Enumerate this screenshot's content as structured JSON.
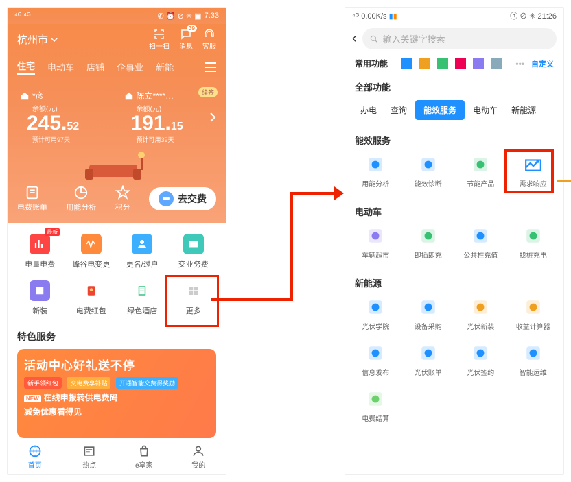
{
  "left": {
    "status": {
      "left": "⁴ᴳ ⁴ᴳ",
      "right": "7:33",
      "icons": "✆ ⏰ ⊘ ✳ ▣"
    },
    "city": "杭州市",
    "top_icons": {
      "scan": "扫一扫",
      "msg": "消息",
      "msg_badge": "39",
      "cs": "客服"
    },
    "tabs": [
      "住宅",
      "电动车",
      "店铺",
      "企事业",
      "新能"
    ],
    "accounts": [
      {
        "name": "*彦",
        "balance_label": "余额(元)",
        "amount_int": "245.",
        "amount_dec": "52",
        "predict": "预计可用97天"
      },
      {
        "name": "陈立****…",
        "balance_label": "余额(元)",
        "amount_int": "191.",
        "amount_dec": "15",
        "predict": "预计可用39天",
        "renew": "续签"
      }
    ],
    "toolbar": {
      "bill": "电费账单",
      "usage": "用能分析",
      "points": "积分",
      "pay": "去交费"
    },
    "grid": [
      {
        "label": "电量电费",
        "new": "最新"
      },
      {
        "label": "峰谷电变更"
      },
      {
        "label": "更名/过户"
      },
      {
        "label": "交业务费"
      },
      {
        "label": "新装"
      },
      {
        "label": "电费红包"
      },
      {
        "label": "绿色酒店"
      },
      {
        "label": "更多"
      }
    ],
    "special_title": "特色服务",
    "promo": {
      "title": "活动中心好礼送不停",
      "pills": [
        "新手领红包",
        "交电费享补贴",
        "开通智能交费得奖励"
      ],
      "line1": "在线申报转供电费码",
      "line2": "减免优惠看得见",
      "new": "NEW"
    },
    "nav": [
      "首页",
      "热点",
      "e享家",
      "我的"
    ]
  },
  "right": {
    "status": {
      "left": "⁴ᴳ 0.00K/s",
      "right": "21:26",
      "icons": "ⓝ ⊘ ✳"
    },
    "search_placeholder": "输入关键字搜索",
    "fav_title": "常用功能",
    "fav_customize": "自定义",
    "all_title": "全部功能",
    "tabs": [
      "办电",
      "查询",
      "能效服务",
      "电动车",
      "新能源"
    ],
    "sections": [
      {
        "title": "能效服务",
        "items": [
          {
            "label": "用能分析",
            "c": "#1e90ff"
          },
          {
            "label": "能效诊断",
            "c": "#1e90ff"
          },
          {
            "label": "节能产品",
            "c": "#38c172"
          },
          {
            "label": "需求响应",
            "c": "#1e90ff",
            "feat": true
          }
        ]
      },
      {
        "title": "电动车",
        "items": [
          {
            "label": "车辆超市",
            "c": "#8a7cf0"
          },
          {
            "label": "即插即充",
            "c": "#38c172"
          },
          {
            "label": "公共桩充值",
            "c": "#1e90ff"
          },
          {
            "label": "找桩充电",
            "c": "#38c172"
          }
        ]
      },
      {
        "title": "新能源",
        "items": [
          {
            "label": "光伏学院",
            "c": "#1e90ff"
          },
          {
            "label": "设备采购",
            "c": "#1e90ff"
          },
          {
            "label": "光伏新装",
            "c": "#f0a020"
          },
          {
            "label": "收益计算器",
            "c": "#f0a020"
          },
          {
            "label": "信息发布",
            "c": "#1e90ff"
          },
          {
            "label": "光伏账单",
            "c": "#1e90ff"
          },
          {
            "label": "光伏签约",
            "c": "#1e90ff"
          },
          {
            "label": "智能运维",
            "c": "#1e90ff"
          },
          {
            "label": "电费结算",
            "c": "#6dd06d"
          }
        ]
      }
    ]
  }
}
